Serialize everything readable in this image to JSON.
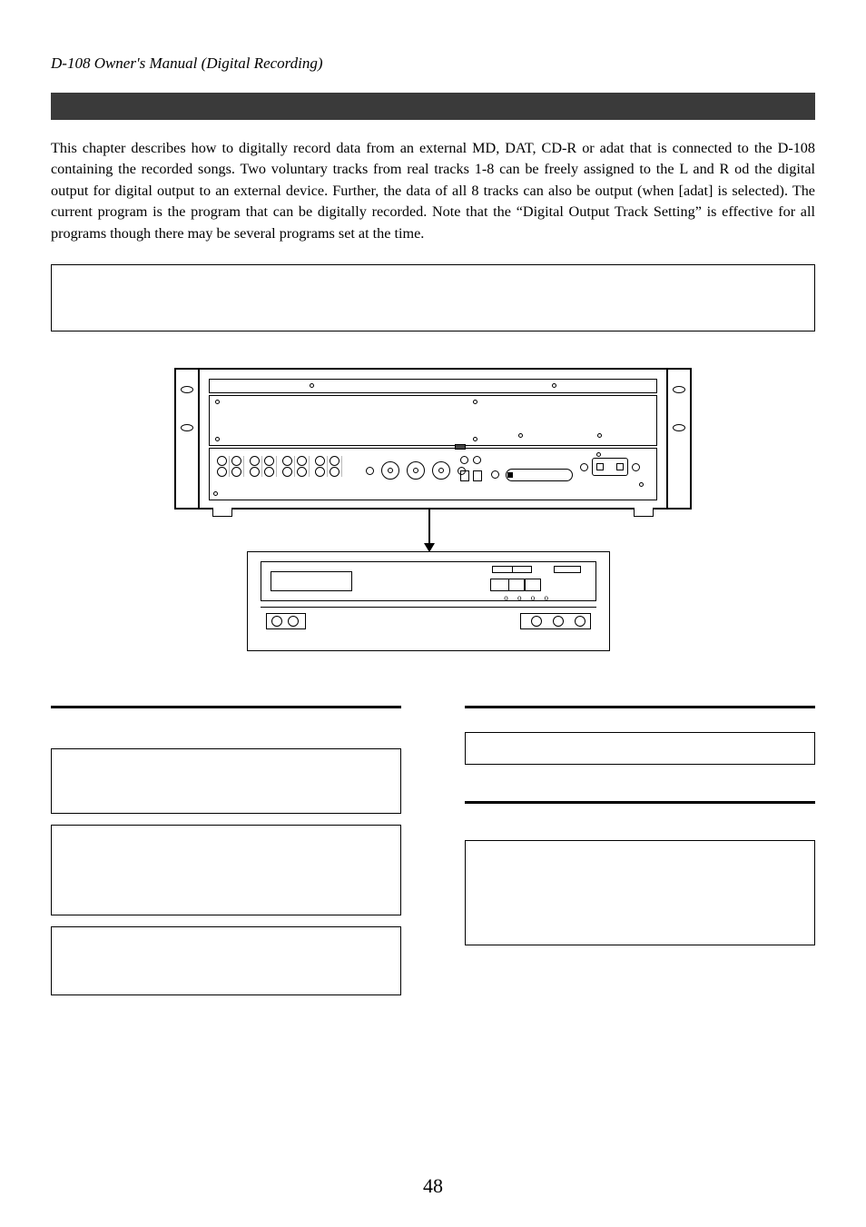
{
  "header": "D-108 Owner's Manual (Digital Recording)",
  "body_paragraph": "This chapter describes how to digitally record data from an external MD, DAT, CD-R or adat that is connected to the D-108 containing the recorded songs.  Two voluntary tracks from real tracks 1-8 can be freely assigned to the L and R od the digital output for digital output to an external device.  Further, the data of all 8 tracks can also be output (when [adat] is selected).  The current program is the program that can be digitally recorded.  Note that the “Digital Output Track Setting” is effective for all programs though there may be several programs set at the time.",
  "page_number": "48"
}
